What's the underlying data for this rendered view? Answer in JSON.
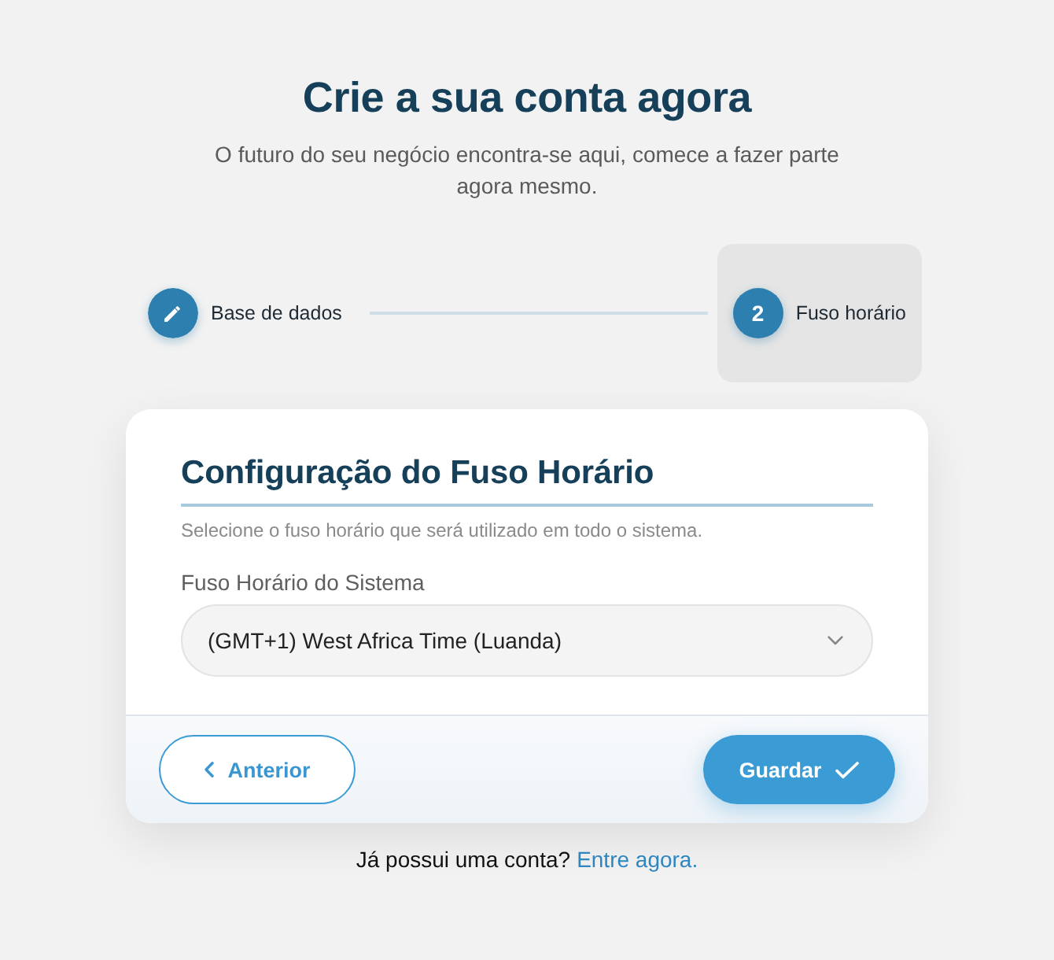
{
  "header": {
    "title": "Crie a sua conta agora",
    "subtitle": "O futuro do seu negócio encontra-se aqui, comece a fazer parte agora mesmo."
  },
  "steps": [
    {
      "kind": "edit",
      "label": "Base de dados",
      "selected": false
    },
    {
      "kind": "number",
      "number": "2",
      "label": "Fuso horário",
      "selected": true
    }
  ],
  "card": {
    "title": "Configuração do Fuso Horário",
    "description": "Selecione o fuso horário que será utilizado em todo o sistema.",
    "field": {
      "label": "Fuso Horário do Sistema",
      "value": "(GMT+1) West Africa Time (Luanda)"
    },
    "buttons": [
      {
        "kind": "back",
        "label": "Anterior"
      },
      {
        "kind": "submit",
        "label": "Guardar"
      }
    ]
  },
  "footer": {
    "text": "Já possui uma conta?",
    "link": "Entre agora."
  }
}
